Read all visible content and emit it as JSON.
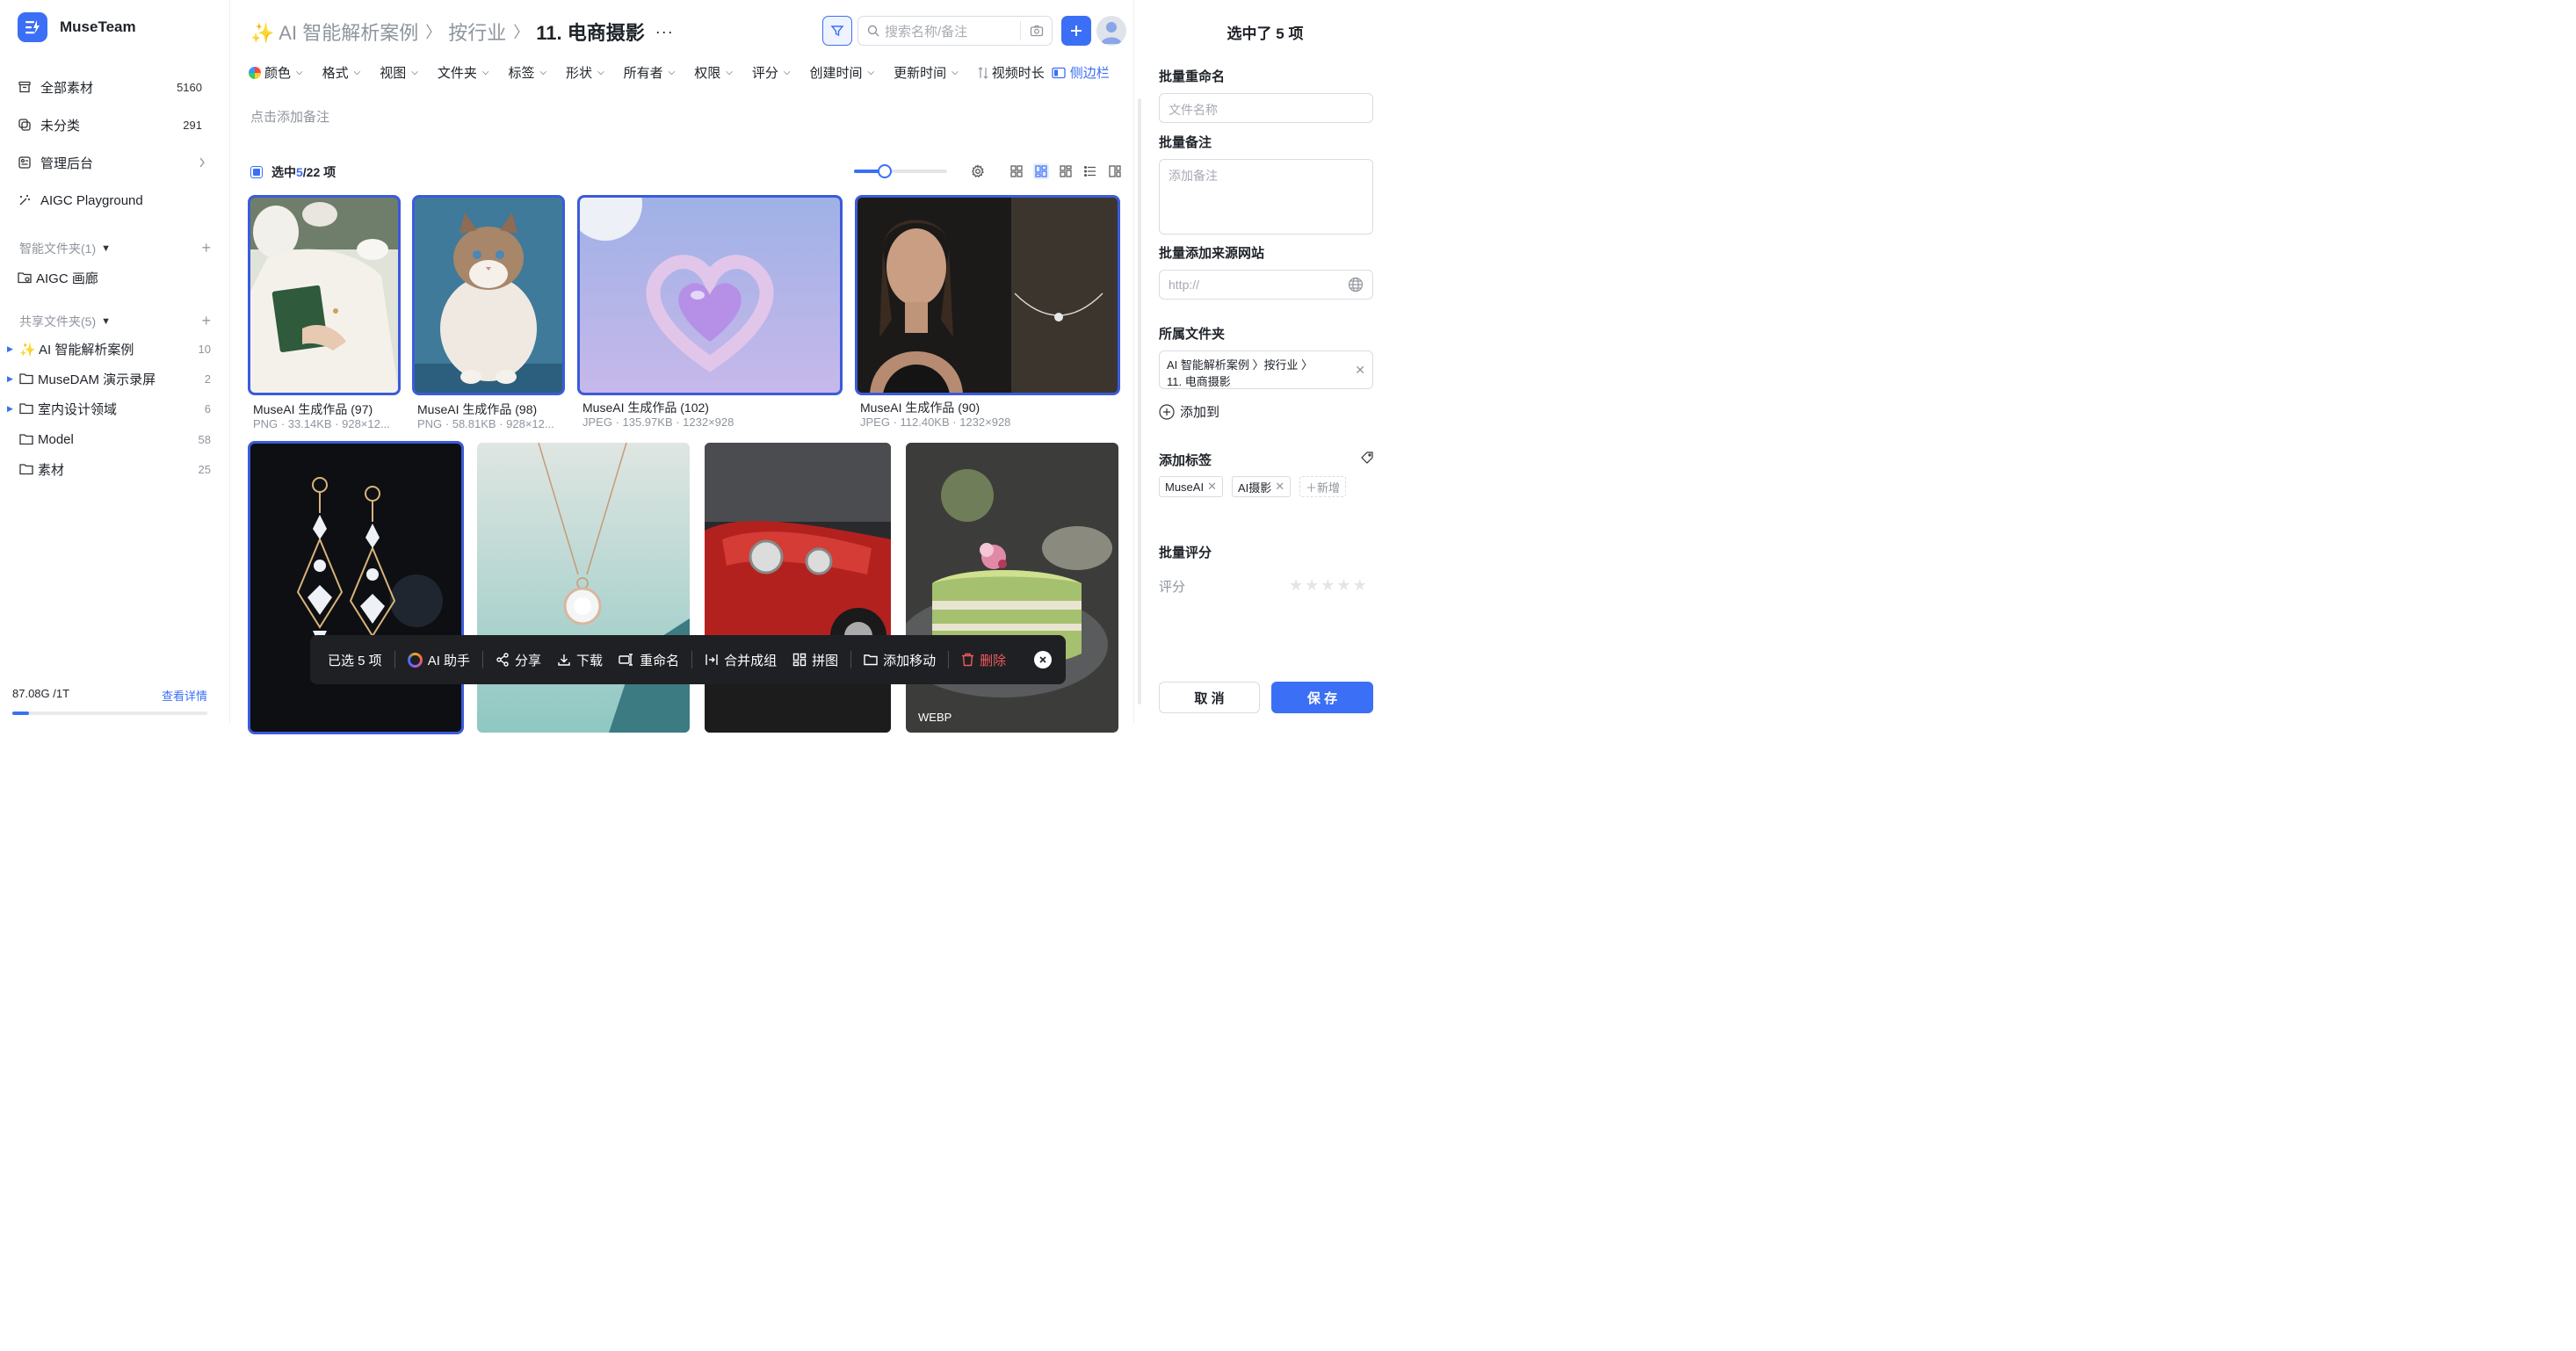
{
  "brand": {
    "name": "MuseTeam"
  },
  "sidebar": {
    "items": [
      {
        "label": "全部素材",
        "count": "5160"
      },
      {
        "label": "未分类",
        "count": "291"
      },
      {
        "label": "管理后台"
      },
      {
        "label": "AIGC Playground"
      }
    ],
    "smart_section": "智能文件夹(1)",
    "smart_folders": [
      {
        "label": "AIGC 画廊"
      }
    ],
    "shared_section": "共享文件夹(5)",
    "shared_folders": [
      {
        "label": "✨ AI 智能解析案例",
        "count": "10"
      },
      {
        "label": "MuseDAM 演示录屏",
        "count": "2"
      },
      {
        "label": "室内设计领域",
        "count": "6"
      },
      {
        "label": "Model",
        "count": "58"
      },
      {
        "label": "素材",
        "count": "25"
      }
    ],
    "storage": {
      "used": "87.08G /1T",
      "link": "查看详情",
      "fraction": 0.087
    }
  },
  "header": {
    "crumbs": [
      "✨ AI 智能解析案例",
      "按行业",
      "11. 电商摄影"
    ],
    "more": "···",
    "search_placeholder": "搜索名称/备注"
  },
  "filters": [
    "颜色",
    "格式",
    "视图",
    "文件夹",
    "标签",
    "形状",
    "所有者",
    "权限",
    "评分",
    "创建时间",
    "更新时间"
  ],
  "sort_label": "视频时长",
  "sidebar_toggle": "侧边栏",
  "note_placeholder": "点击添加备注",
  "selection": {
    "prefix": "选中 ",
    "selected": "5",
    "total": "/22 项"
  },
  "colors": {
    "accent": "#3b6ff5",
    "selected_outline": "#3b5bdb",
    "danger": "#f05a5a",
    "toolbar_bg": "#1f2024"
  },
  "assets": [
    {
      "title": "MuseAI 生成作品 (97)",
      "meta": "PNG · 33.14KB · 928×12...",
      "selected": true
    },
    {
      "title": "MuseAI 生成作品 (98)",
      "meta": "PNG · 58.81KB · 928×12...",
      "selected": true
    },
    {
      "title": "MuseAI 生成作品 (102)",
      "meta": "JPEG · 135.97KB · 1232×928",
      "selected": true
    },
    {
      "title": "MuseAI 生成作品 (90)",
      "meta": "JPEG · 112.40KB · 1232×928",
      "selected": true
    },
    {
      "selected": true
    },
    {
      "selected": false
    },
    {
      "selected": false
    },
    {
      "selected": false,
      "badge": "WEBP"
    }
  ],
  "actionbar": {
    "count": "已选 5 项",
    "actions": [
      "AI 助手",
      "分享",
      "下载",
      "重命名",
      "合并成组",
      "拼图",
      "添加移动",
      "删除"
    ]
  },
  "panel": {
    "title": "选中了 5 项",
    "rename_label": "批量重命名",
    "rename_placeholder": "文件名称",
    "note_label": "批量备注",
    "note_placeholder": "添加备注",
    "source_label": "批量添加来源网站",
    "source_placeholder": "http://",
    "folder_label": "所属文件夹",
    "folder_path_1": "AI 智能解析案例 〉按行业 〉",
    "folder_path_2": "11. 电商摄影",
    "add_to": "添加到",
    "tags_label": "添加标签",
    "tags": [
      "MuseAI",
      "AI摄影"
    ],
    "add_tag": "新增",
    "rating_label": "批量评分",
    "rating_field": "评分",
    "rating": 0,
    "cancel": "取 消",
    "save": "保 存"
  }
}
